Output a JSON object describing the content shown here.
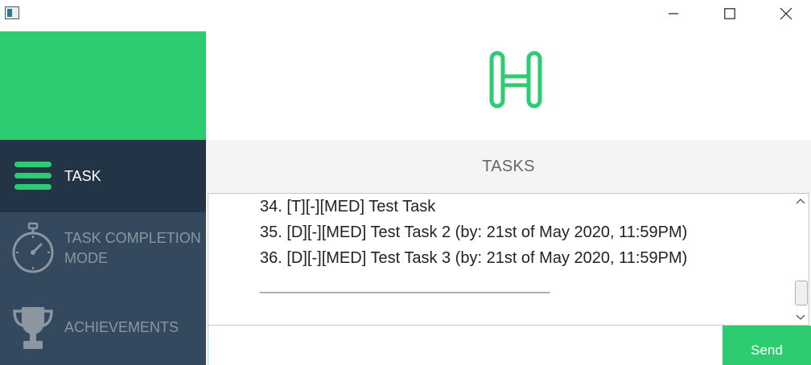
{
  "window": {
    "icons": {
      "app": "app-icon",
      "minimize": "minimize-icon",
      "maximize": "maximize-icon",
      "close": "close-icon"
    }
  },
  "sidebar": {
    "items": [
      {
        "label": "TASK",
        "icon": "hamburger-menu-icon",
        "active": true
      },
      {
        "label": "TASK COMPLETION MODE",
        "icon": "stopwatch-icon",
        "active": false
      },
      {
        "label": "ACHIEVEMENTS",
        "icon": "trophy-icon",
        "active": false
      }
    ]
  },
  "header": {
    "logo": "h-logo-icon"
  },
  "main": {
    "section_title": "TASKS",
    "output_lines": [
      "34. [T][-][MED] Test Task",
      "35. [D][-][MED] Test Task 2 (by: 21st of May 2020, 11:59PM)",
      "36. [D][-][MED] Test Task 3 (by: 21st of May 2020, 11:59PM)"
    ],
    "separator": "____________________________________"
  },
  "input": {
    "value": "",
    "send_label": "Send"
  },
  "colors": {
    "accent": "#2ecc71",
    "sidebar": "#34495e",
    "sidebar_active": "#243447"
  }
}
